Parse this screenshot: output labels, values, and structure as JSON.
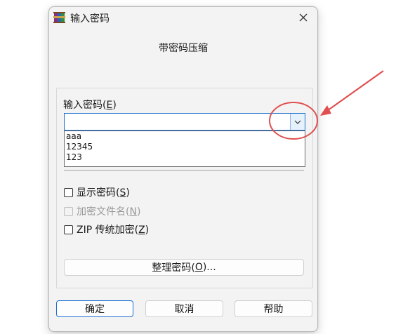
{
  "window": {
    "title": "输入密码",
    "subtitle": "带密码压缩"
  },
  "password": {
    "label_prefix": "输入密码(",
    "label_key": "E",
    "label_suffix": ")",
    "value": "",
    "options": [
      "aaa",
      "12345",
      "123"
    ]
  },
  "checkboxes": {
    "show": {
      "prefix": "显示密码(",
      "key": "S",
      "suffix": ")",
      "checked": false,
      "enabled": true
    },
    "encrypt_names": {
      "prefix": "加密文件名(",
      "key": "N",
      "suffix": ")",
      "checked": false,
      "enabled": false
    },
    "zip_legacy": {
      "prefix": "ZIP 传统加密(",
      "key": "Z",
      "suffix": ")",
      "checked": false,
      "enabled": true
    }
  },
  "organize_button": {
    "prefix": "整理密码(",
    "key": "O",
    "suffix": ")..."
  },
  "footer": {
    "ok": "确定",
    "cancel": "取消",
    "help": "帮助"
  },
  "colors": {
    "accent": "#1c6fd1",
    "annotation": "#e05050"
  },
  "icons": {
    "app": "winrar-books-icon",
    "close": "close-icon",
    "dropdown": "chevron-down-icon"
  }
}
